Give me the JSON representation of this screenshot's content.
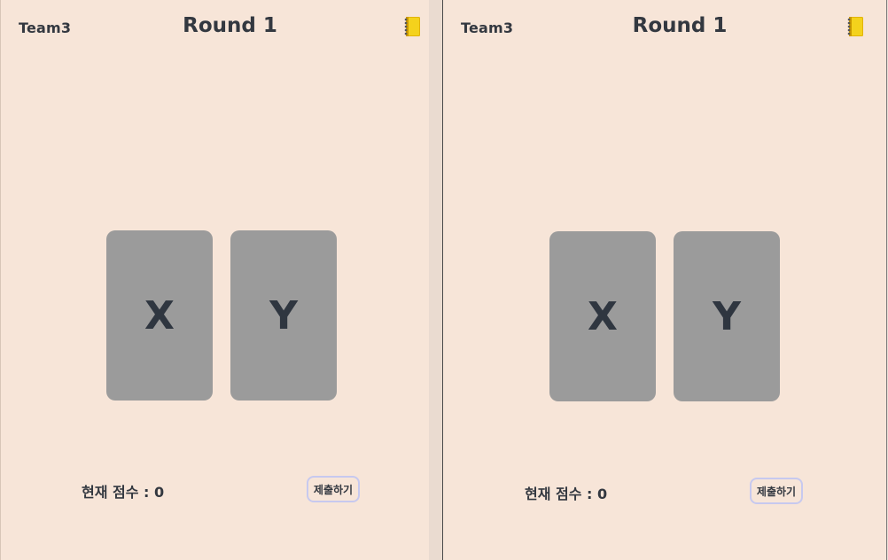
{
  "colors": {
    "background": "#f7e5d8",
    "card": "#9b9b9b",
    "text": "#333840",
    "button_border": "#c7c9ef"
  },
  "panels": [
    {
      "team": "Team3",
      "round": "Round 1",
      "icon": "notebook-icon",
      "cards": [
        "X",
        "Y"
      ],
      "score_label": "현재 점수 : 0",
      "submit_label": "제출하기"
    },
    {
      "team": "Team3",
      "round": "Round 1",
      "icon": "notebook-icon",
      "cards": [
        "X",
        "Y"
      ],
      "score_label": "현재 점수 : 0",
      "submit_label": "제출하기"
    }
  ]
}
